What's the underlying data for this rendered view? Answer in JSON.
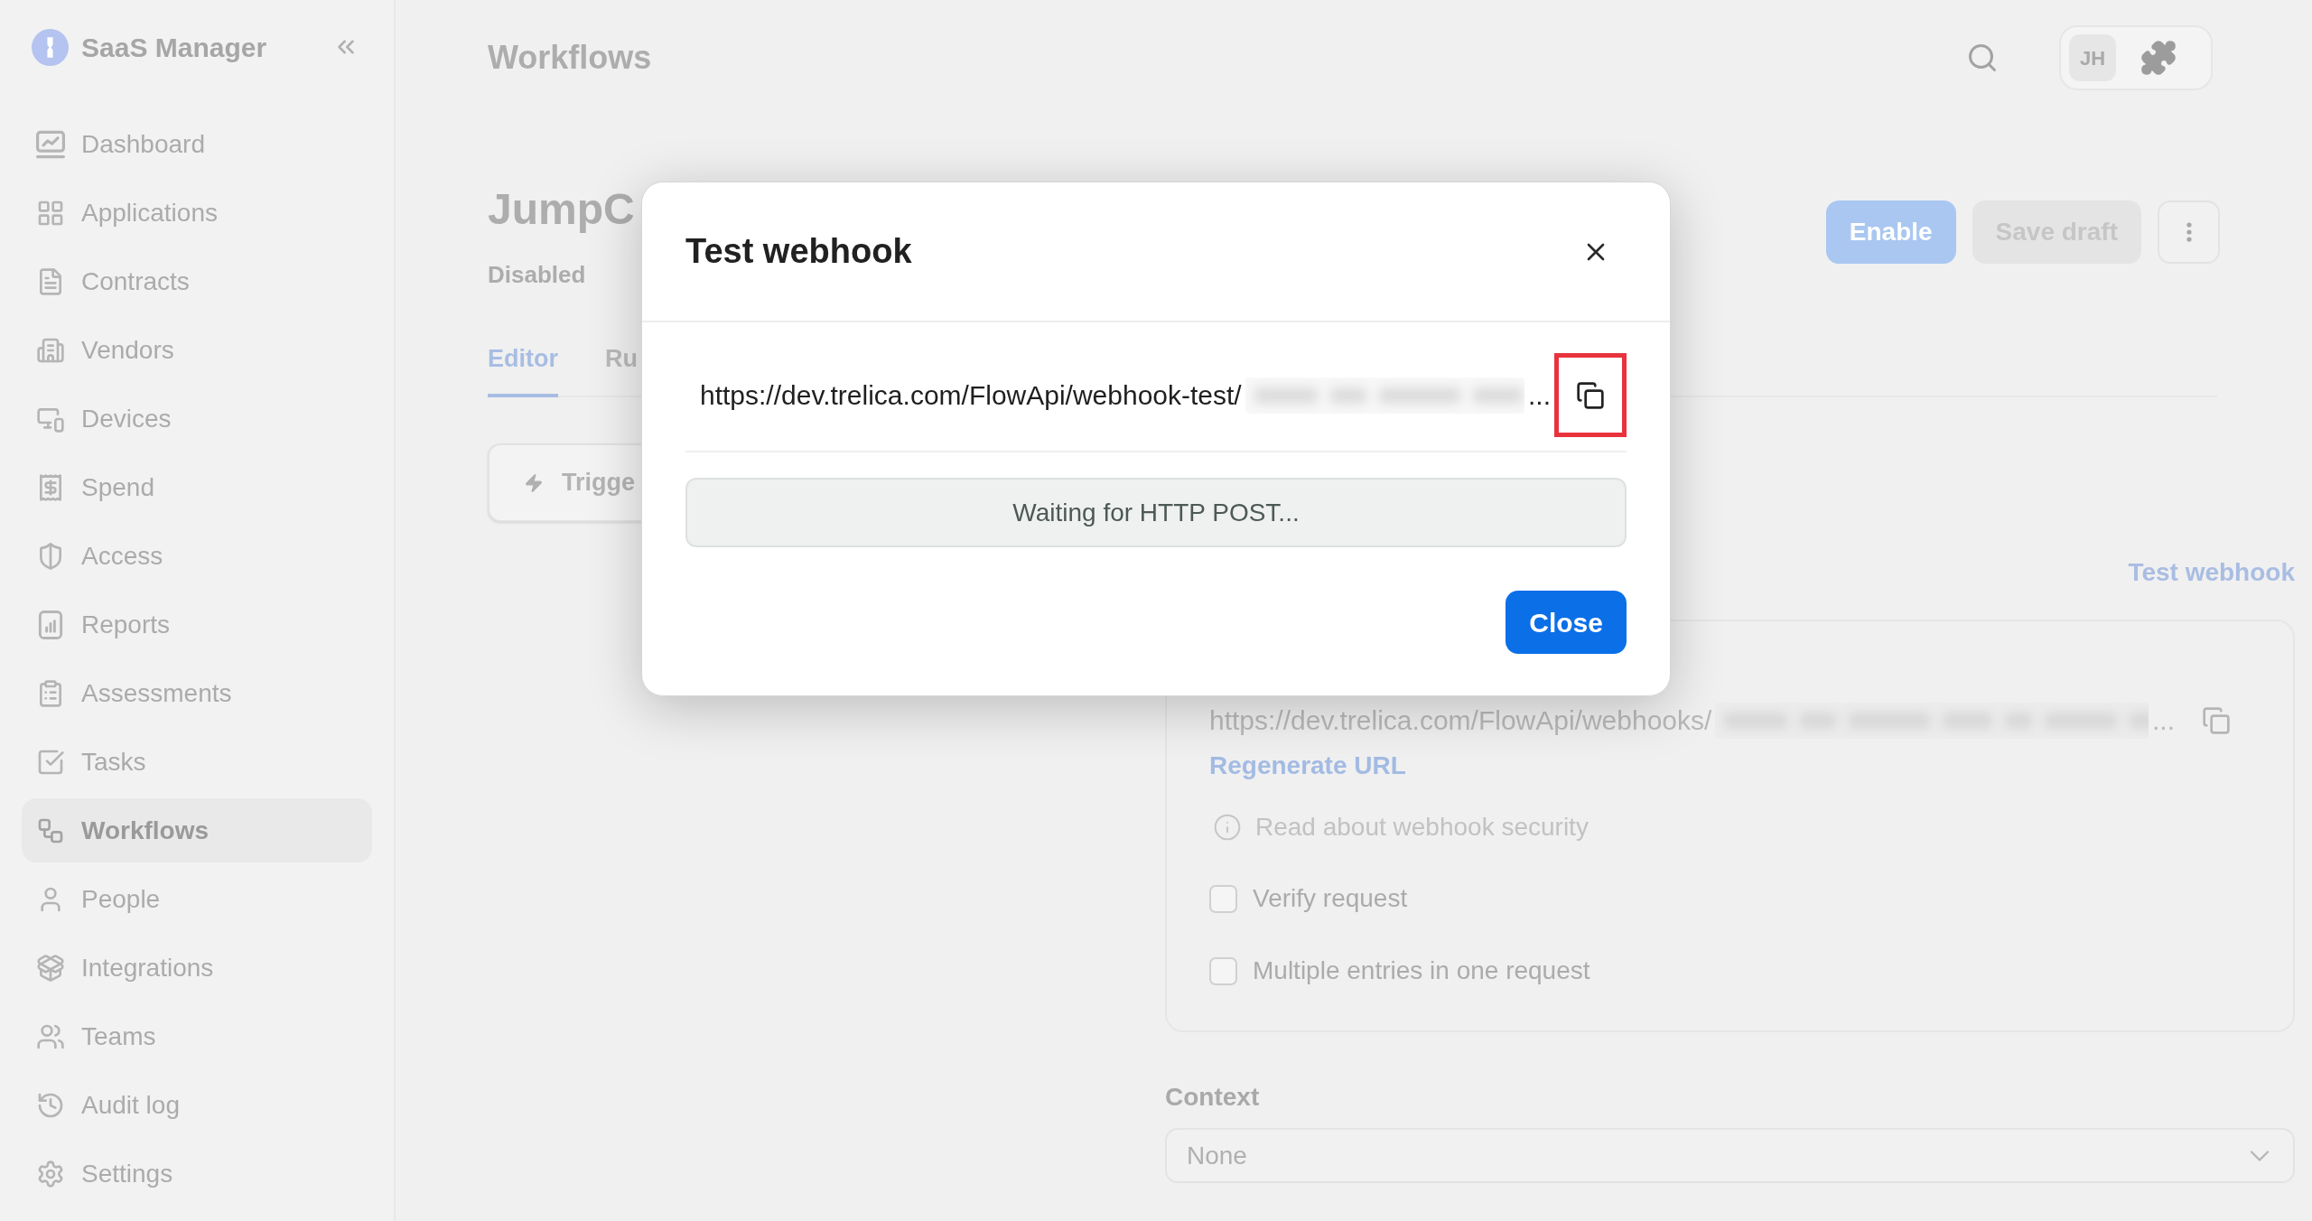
{
  "sidebar": {
    "brand": "SaaS Manager",
    "items": [
      {
        "label": "Dashboard",
        "selected": false
      },
      {
        "label": "Applications",
        "selected": false
      },
      {
        "label": "Contracts",
        "selected": false
      },
      {
        "label": "Vendors",
        "selected": false
      },
      {
        "label": "Devices",
        "selected": false
      },
      {
        "label": "Spend",
        "selected": false
      },
      {
        "label": "Access",
        "selected": false
      },
      {
        "label": "Reports",
        "selected": false
      },
      {
        "label": "Assessments",
        "selected": false
      },
      {
        "label": "Tasks",
        "selected": false
      },
      {
        "label": "Workflows",
        "selected": true
      },
      {
        "label": "People",
        "selected": false
      },
      {
        "label": "Integrations",
        "selected": false
      },
      {
        "label": "Teams",
        "selected": false
      },
      {
        "label": "Audit log",
        "selected": false
      },
      {
        "label": "Settings",
        "selected": false
      }
    ]
  },
  "header": {
    "title": "Workflows",
    "user": {
      "initials": "JH"
    }
  },
  "workflow": {
    "name": "JumpC",
    "status": "Disabled",
    "buttons": [
      {
        "kind": "primary",
        "label": "Enable",
        "disabled": false
      },
      {
        "kind": "secondary",
        "label": "Save draft",
        "disabled": true
      },
      {
        "kind": "more"
      }
    ]
  },
  "tabs": [
    {
      "label": "Editor",
      "selected": true
    },
    {
      "label": "Ru",
      "selected": false
    }
  ],
  "trigger": {
    "label": "Trigge"
  },
  "webhook_panel": {
    "test_link": "Test webhook",
    "url": "https://dev.trelica.com/FlowApi/webhooks/",
    "url_tail": "...",
    "regenerate_link": "Regenerate URL",
    "security_link": "Read about webhook security",
    "options": [
      {
        "label": "Verify request",
        "checked": false
      },
      {
        "label": "Multiple entries in one request",
        "checked": false
      }
    ]
  },
  "context": {
    "label": "Context",
    "value": "None"
  },
  "dialog": {
    "title": "Test webhook",
    "url": "https://dev.trelica.com/FlowApi/webhook-test/",
    "url_tail": "...",
    "copy_button": {
      "highlighted": true
    },
    "status": "Waiting for HTTP POST...",
    "buttons": [
      {
        "label": "Close"
      }
    ]
  }
}
